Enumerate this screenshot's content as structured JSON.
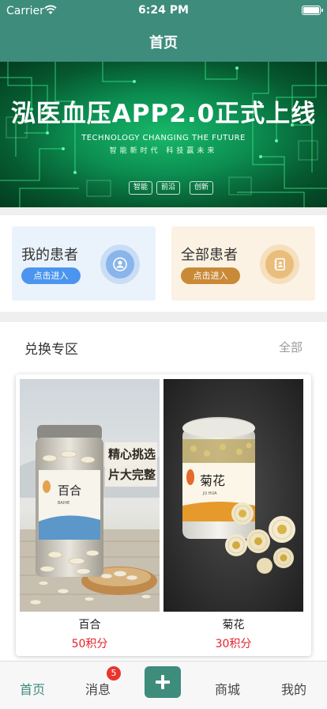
{
  "status_bar": {
    "carrier": "Carrier",
    "time": "6:24 PM"
  },
  "nav": {
    "title": "首页"
  },
  "banner": {
    "title": "泓医血压APP2.0正式上线",
    "subtitle_en": "TECHNOLOGY CHANGING THE FUTURE",
    "subtitle_cn": "智能新时代 科技赢未来",
    "chips": [
      "智能",
      "前沿",
      "创新"
    ]
  },
  "patients": {
    "mine": {
      "title": "我的患者",
      "button": "点击进入"
    },
    "all": {
      "title": "全部患者",
      "button": "点击进入"
    }
  },
  "exchange": {
    "title": "兑换专区",
    "all_label": "全部",
    "products": [
      {
        "name": "百合",
        "price": "50积分",
        "label_cn": "百合",
        "label_en": "BAIHE",
        "slogan1": "精心挑选",
        "slogan2": "片大完整"
      },
      {
        "name": "菊花",
        "price": "30积分",
        "label_cn": "菊花",
        "label_en": "JU HUA"
      }
    ]
  },
  "tabbar": {
    "items": [
      "首页",
      "消息",
      "商城",
      "我的"
    ],
    "badge": "5",
    "accent": "#3e8c7c"
  }
}
